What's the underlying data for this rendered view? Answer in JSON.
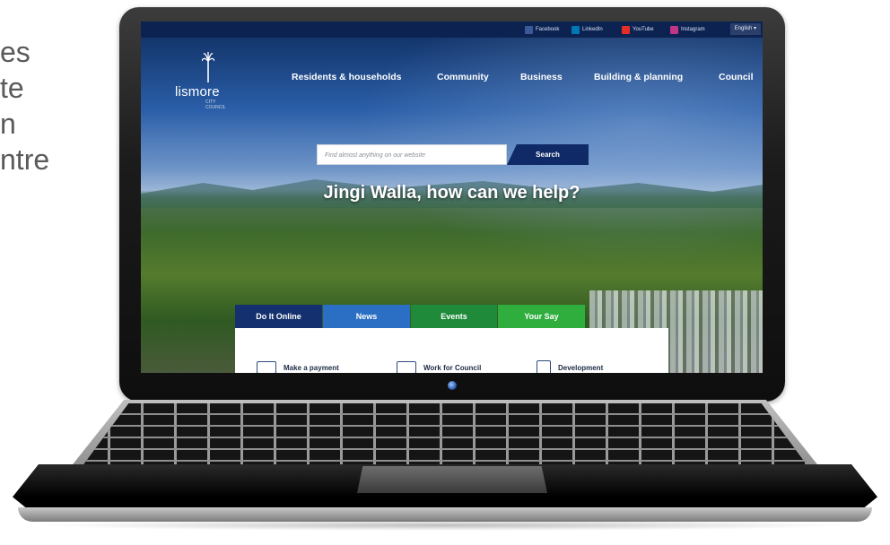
{
  "side_text": [
    "es",
    "te",
    "n",
    "ntre"
  ],
  "site": {
    "logo_text": "lismore",
    "logo_sub": "CITY COUNCIL",
    "social": [
      {
        "label": "Facebook",
        "icon": "facebook-icon",
        "color": "#3b5998"
      },
      {
        "label": "LinkedIn",
        "icon": "linkedin-icon",
        "color": "#0077b5"
      },
      {
        "label": "YouTube",
        "icon": "youtube-icon",
        "color": "#e52d27"
      },
      {
        "label": "Instagram",
        "icon": "instagram-icon",
        "color": "#c13584"
      }
    ],
    "language": "English ▾",
    "nav": [
      "Residents & households",
      "Community",
      "Business",
      "Building & planning",
      "Council"
    ],
    "search": {
      "placeholder": "Find almost anything on our website",
      "button": "Search"
    },
    "headline": "Jingi Walla, how can we help?",
    "tabs": [
      {
        "label": "Do It Online",
        "color": "#14306e"
      },
      {
        "label": "News",
        "color": "#2a6fc4"
      },
      {
        "label": "Events",
        "color": "#1f8a3a"
      },
      {
        "label": "Your Say",
        "color": "#2fae3e"
      }
    ],
    "cards": [
      {
        "label": "Make a payment",
        "icon": "payment-icon"
      },
      {
        "label": "Work for Council",
        "icon": "briefcase-icon"
      },
      {
        "label": "Development",
        "icon": "building-icon"
      }
    ]
  }
}
